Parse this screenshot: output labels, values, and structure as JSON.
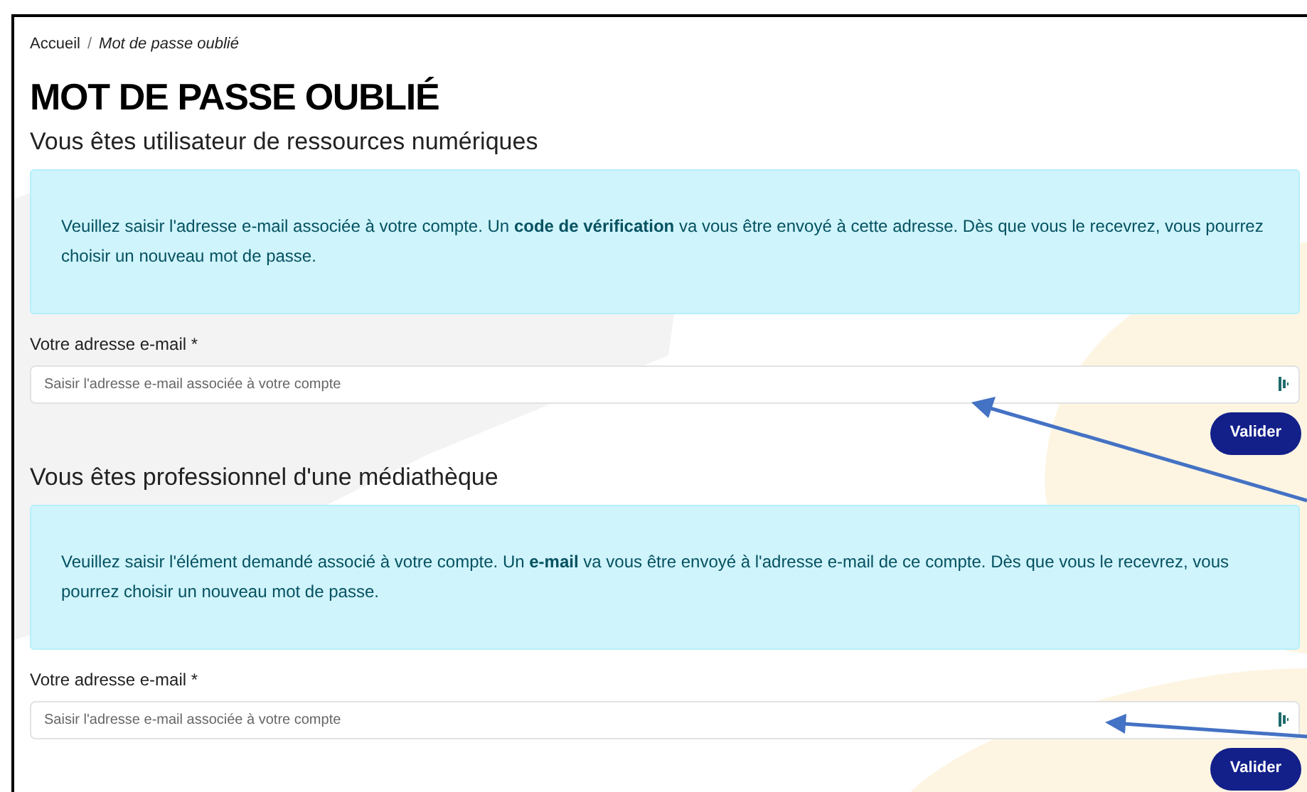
{
  "breadcrumb": {
    "items": [
      "Accueil",
      "Mot de passe oublié"
    ],
    "separator": "/"
  },
  "title": "MOT DE PASSE OUBLIÉ",
  "sections": [
    {
      "heading": "Vous êtes utilisateur de ressources numériques",
      "info": "Veuillez saisir l'adresse e-mail associée à votre compte. Un **code de vérification** va vous être envoyé à cette adresse. Dès que vous le recevrez, vous pourrez choisir un nouveau mot de passe.",
      "field_label": "Votre adresse e-mail *",
      "placeholder": "Saisir l'adresse e-mail associée à votre compte",
      "button": "Valider"
    },
    {
      "heading": "Vous êtes professionnel d'une médiathèque",
      "info": "Veuillez saisir l'élément demandé associé à votre compte. Un **e-mail** va vous être envoyé à l'adresse e-mail de ce compte. Dès que vous le recevrez, vous pourrez choisir un nouveau mot de passe.",
      "field_label": "Votre adresse e-mail *",
      "placeholder": "Saisir l'adresse e-mail associée à votre compte",
      "button": "Valider"
    }
  ]
}
